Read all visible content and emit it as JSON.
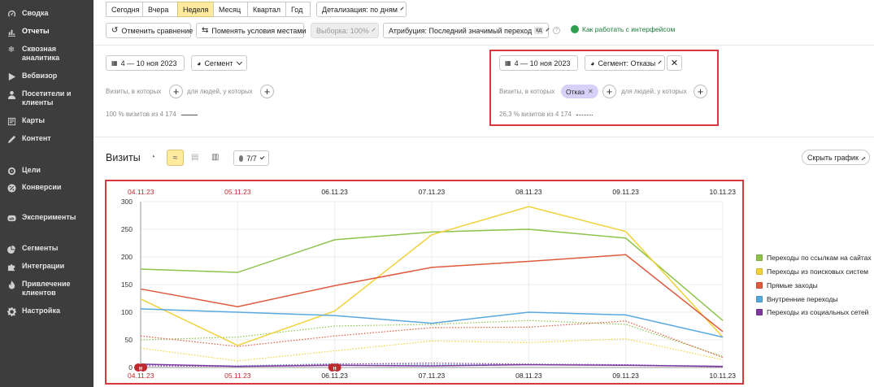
{
  "sidebar": {
    "items": [
      {
        "label": "Сводка",
        "icon": "gauge-icon"
      },
      {
        "label": "Отчеты",
        "icon": "bar-chart-icon"
      },
      {
        "label": "Сквозная аналитика",
        "icon": "snowflake-icon"
      },
      {
        "label": "Вебвизор",
        "icon": "play-icon"
      },
      {
        "label": "Посетители и клиенты",
        "icon": "user-icon"
      },
      {
        "label": "Карты",
        "icon": "map-icon"
      },
      {
        "label": "Контент",
        "icon": "pen-icon"
      },
      {
        "label": "Цели",
        "icon": "target-icon"
      },
      {
        "label": "Конверсии",
        "icon": "percent-icon"
      },
      {
        "label": "Эксперименты",
        "icon": "ab-icon"
      },
      {
        "label": "Сегменты",
        "icon": "pie-icon"
      },
      {
        "label": "Интеграции",
        "icon": "puzzle-icon"
      },
      {
        "label": "Привлечение клиентов",
        "icon": "flame-icon"
      },
      {
        "label": "Настройка",
        "icon": "settings-icon"
      }
    ]
  },
  "period_tabs": [
    {
      "label": "Сегодня",
      "selected": false
    },
    {
      "label": "Вчера",
      "selected": false
    },
    {
      "label": "Неделя",
      "selected": true
    },
    {
      "label": "Месяц",
      "selected": false
    },
    {
      "label": "Квартал",
      "selected": false
    },
    {
      "label": "Год",
      "selected": false
    }
  ],
  "detail_label": "Детализация: по дням",
  "toolbar": {
    "cancel_compare": "Отменить сравнение",
    "swap_conditions": "Поменять условия местами",
    "sample": "Выборка: 100%",
    "attribution": "Атрибуция: Последний значимый переход",
    "attribution_tag": "кд",
    "help_link": "Как работать с интерфейсом"
  },
  "left_segment": {
    "date": "4 — 10 ноя 2023",
    "segment": "Сегмент",
    "visits_label": "Визиты, в которых",
    "people_label": "для людей, у которых",
    "share": "100 % визитов из 4 174"
  },
  "right_segment": {
    "date": "4 — 10 ноя 2023",
    "segment": "Сегмент: Отказы",
    "visits_label": "Визиты, в которых",
    "chip": "Отказ",
    "people_label": "для людей, у которых",
    "share": "26,3 % визитов из 4 174"
  },
  "chart_header": {
    "title": "Визиты",
    "series_count": "7/7",
    "hide_chart": "Скрыть график"
  },
  "chart_data": {
    "type": "line",
    "x": [
      "04.11.23",
      "05.11.23",
      "06.11.23",
      "07.11.23",
      "08.11.23",
      "09.11.23",
      "10.11.23"
    ],
    "top_labels": [
      "04.11.23",
      "05.11.23",
      "06.11.23",
      "07.11.23",
      "08.11.23",
      "09.11.23",
      "10.11.23"
    ],
    "weekend_dates": [
      "04.11.23",
      "05.11.23"
    ],
    "ylim": [
      0,
      300
    ],
    "yticks": [
      0,
      50,
      100,
      150,
      200,
      250,
      300
    ],
    "grid": true,
    "legend_position": "right",
    "series": [
      {
        "name": "Переходы по ссылкам на сайтах",
        "color": "#8dc34a",
        "values": [
          178,
          172,
          231,
          245,
          250,
          234,
          85
        ]
      },
      {
        "name": "Переходы из поисковых систем",
        "color": "#f0d23a",
        "values": [
          124,
          40,
          102,
          240,
          291,
          246,
          55
        ]
      },
      {
        "name": "Прямые заходы",
        "color": "#e05a3e",
        "values": [
          142,
          110,
          148,
          181,
          192,
          204,
          65
        ]
      },
      {
        "name": "Внутренние переходы",
        "color": "#5aa8e0",
        "values": [
          106,
          100,
          94,
          80,
          100,
          95,
          55
        ]
      },
      {
        "name": "Переходы из социальных сетей",
        "color": "#7f3aa0",
        "values": [
          6,
          2,
          4,
          3,
          5,
          4,
          2
        ]
      }
    ],
    "compare_series": [
      {
        "color": "#8dc34a",
        "values": [
          50,
          55,
          75,
          78,
          85,
          78,
          20
        ]
      },
      {
        "color": "#f0d23a",
        "values": [
          35,
          12,
          30,
          48,
          45,
          52,
          14
        ]
      },
      {
        "color": "#e05a3e",
        "values": [
          57,
          38,
          57,
          72,
          73,
          84,
          18
        ]
      },
      {
        "color": "#5aa8e0",
        "values": [
          5,
          3,
          7,
          5,
          6,
          5,
          2
        ]
      },
      {
        "color": "#7f3aa0",
        "values": [
          3,
          2,
          6,
          8,
          6,
          5,
          1
        ]
      }
    ],
    "markers": [
      {
        "x": "04.11.23",
        "label": "н"
      },
      {
        "x": "06.11.23",
        "label": "н"
      }
    ]
  }
}
